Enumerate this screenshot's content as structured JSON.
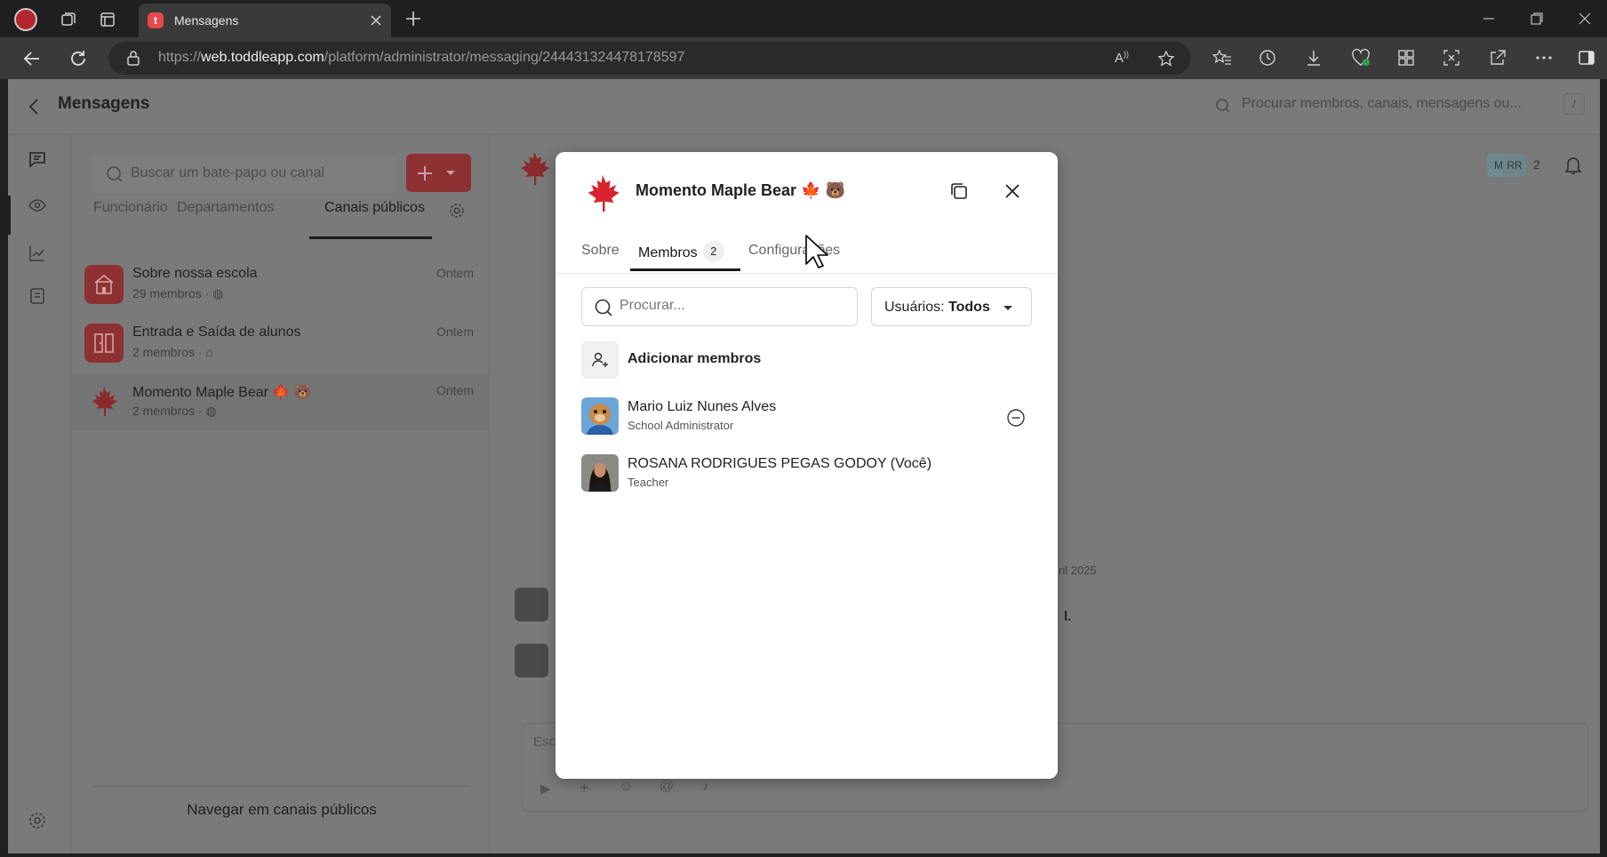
{
  "browser": {
    "tab_title": "Mensagens",
    "tab_favicon_letter": "t",
    "url_prefix": "https://",
    "url_host": "web.toddleapp.com",
    "url_path": "/platform/administrator/messaging/244431324478178597"
  },
  "app": {
    "header_title": "Mensagens",
    "global_search_placeholder": "Procurar membros, canais, mensagens ou...",
    "shortcut_key": "/",
    "header_member_initials_1": "M",
    "header_member_initials_2": "RR",
    "header_member_count": "2"
  },
  "sidebar": {
    "search_placeholder": "Buscar um bate-papo ou canal",
    "tabs": [
      {
        "label": "Funcionário"
      },
      {
        "label": "Departamentos"
      },
      {
        "label": "Canais públicos"
      }
    ],
    "channels": [
      {
        "name": "Sobre nossa escola",
        "sub": "29 membros ·",
        "time": "Ontem"
      },
      {
        "name": "Entrada e Saída de alunos",
        "sub": "2 membros ·",
        "time": "Ontem"
      },
      {
        "name": "Momento Maple Bear 🍁 🐻",
        "sub": "2 membros ·",
        "time": "Ontem"
      }
    ],
    "browse_button": "Navegar em canais públicos"
  },
  "conversation": {
    "date_fragment": "ril 2025",
    "message_fragment": "l.",
    "composer_placeholder": "Escr"
  },
  "modal": {
    "title": "Momento Maple Bear 🍁 🐻",
    "tabs": [
      {
        "label": "Sobre"
      },
      {
        "label": "Membros",
        "count": "2"
      },
      {
        "label": "Configurações"
      }
    ],
    "search_placeholder": "Procurar...",
    "filter_prefix": "Usuários:",
    "filter_value": "Todos",
    "add_members_label": "Adicionar membros",
    "members": [
      {
        "name": "Mario Luiz Nunes Alves",
        "role": "School Administrator"
      },
      {
        "name": "ROSANA RODRIGUES PEGAS GODOY (Você)",
        "role": "Teacher"
      }
    ]
  },
  "colors": {
    "brand_red": "#e8474c",
    "maple_red": "#c8102e",
    "overlay": "#7a7a7a"
  }
}
